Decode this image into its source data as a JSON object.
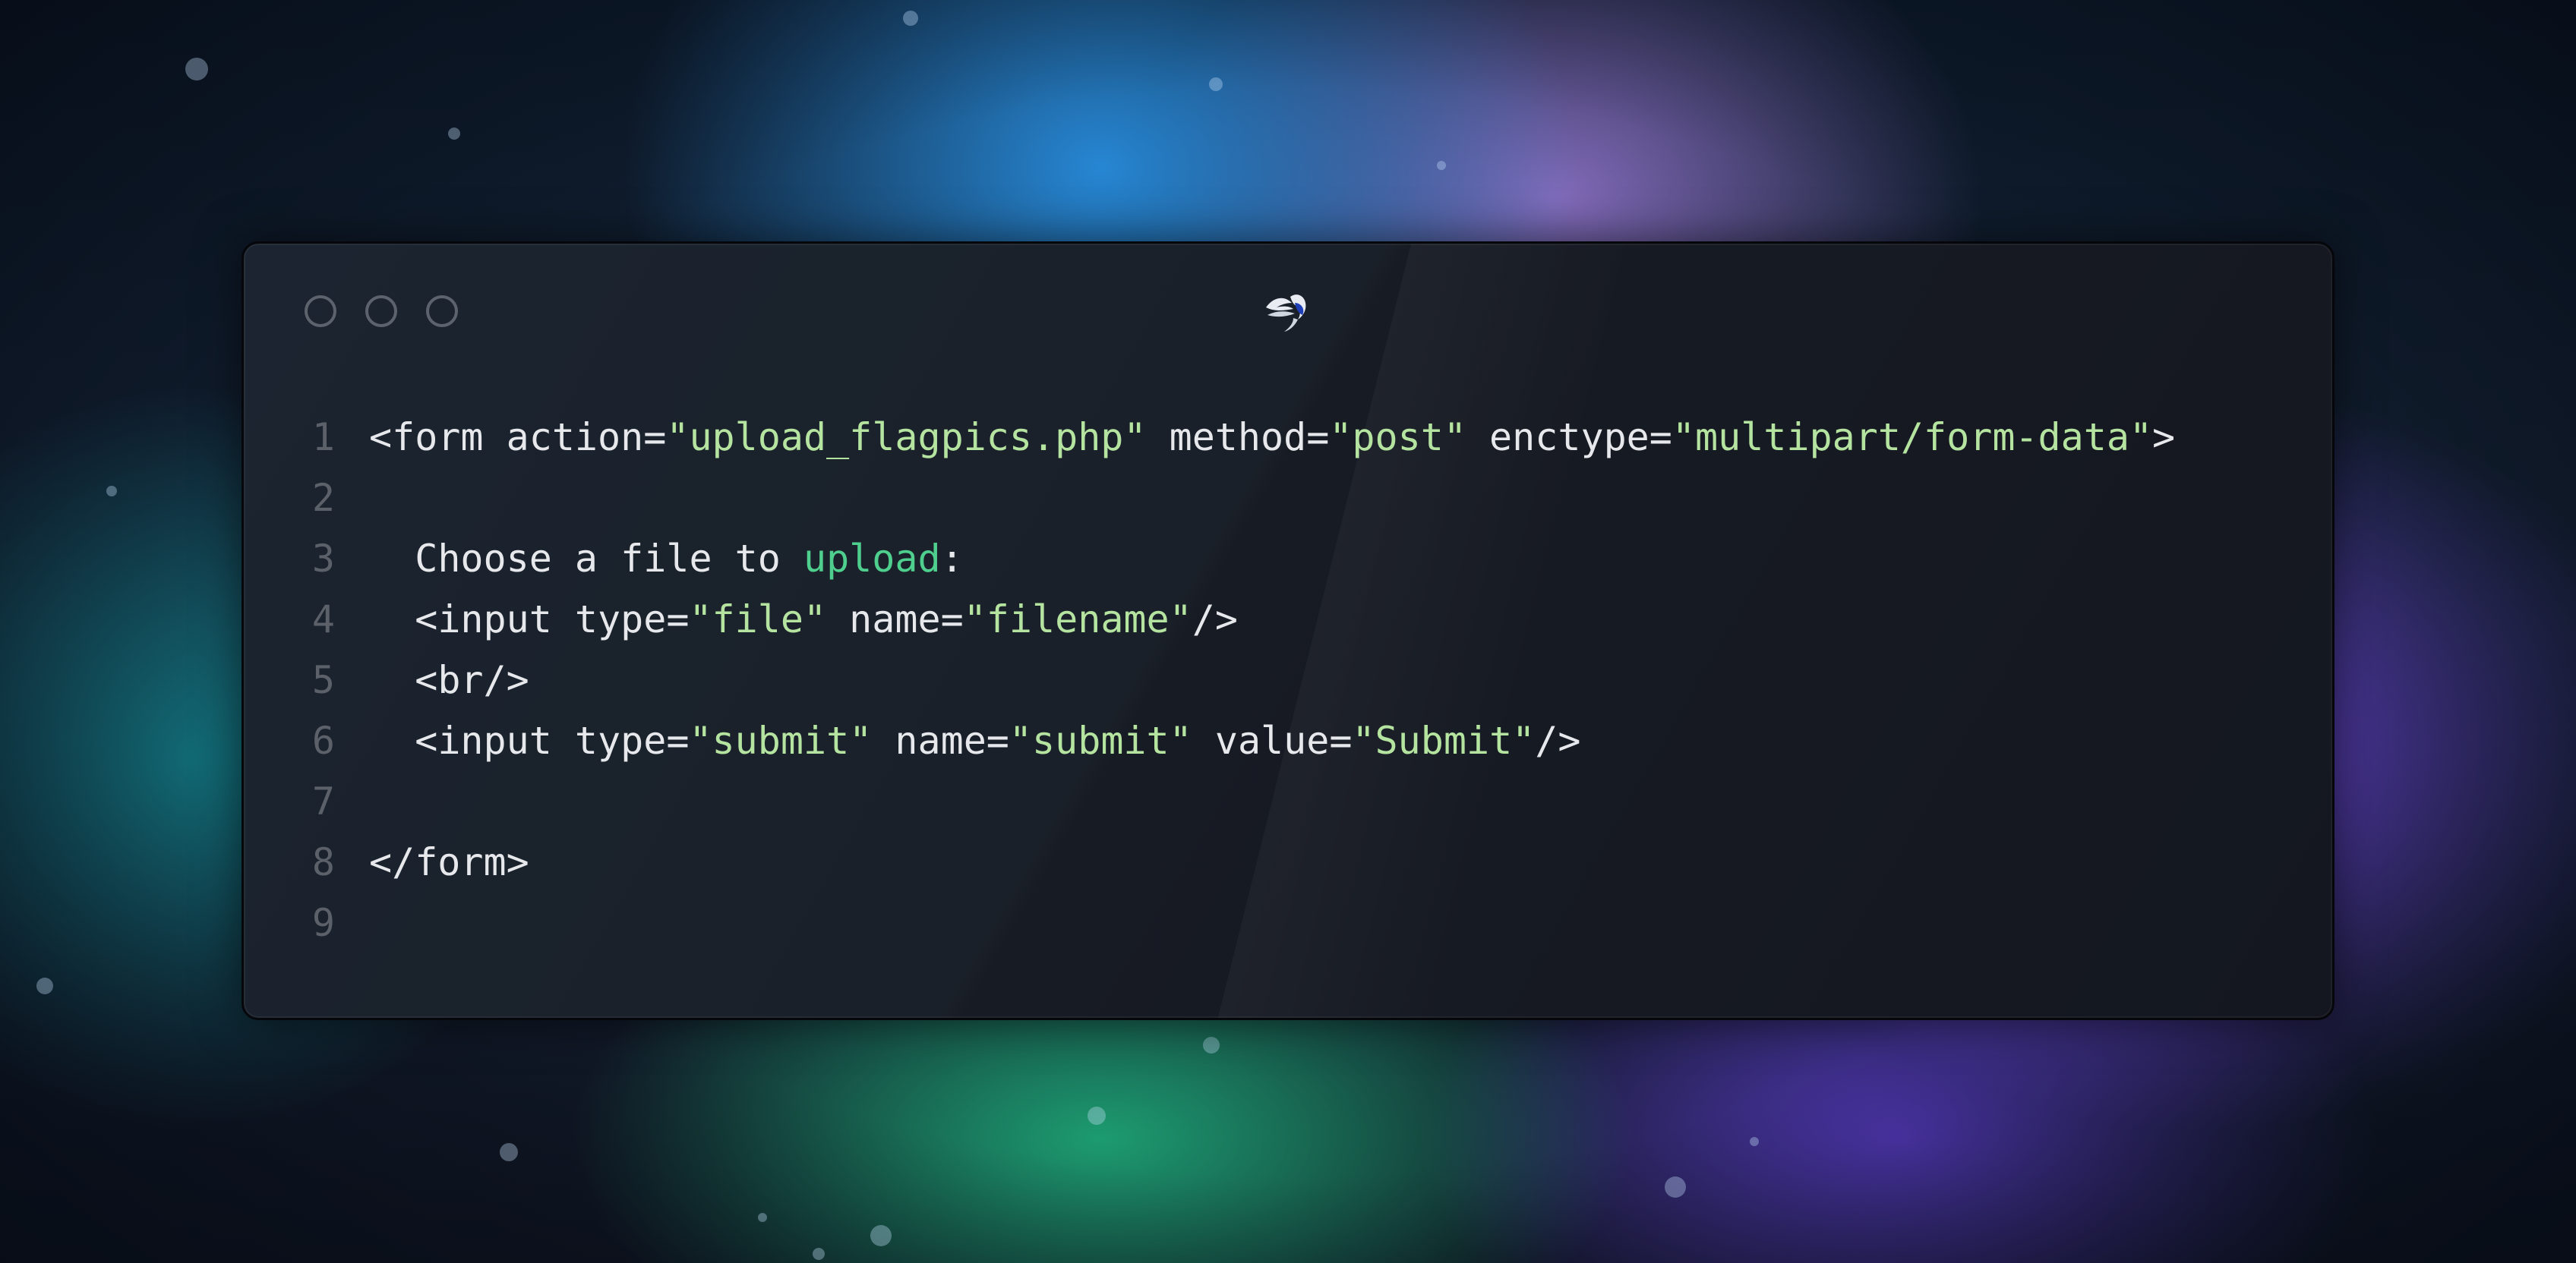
{
  "window": {
    "title_icon": "bird-logo-icon",
    "controls": [
      "close",
      "minimize",
      "maximize"
    ]
  },
  "code": {
    "language": "html",
    "lines": [
      {
        "number": "1",
        "indent": "",
        "tokens": [
          {
            "t": "<form action=",
            "k": "plain"
          },
          {
            "t": "\"upload_flagpics.php\"",
            "k": "str"
          },
          {
            "t": " method=",
            "k": "plain"
          },
          {
            "t": "\"post\"",
            "k": "str"
          },
          {
            "t": " enctype=",
            "k": "plain"
          },
          {
            "t": "\"multipart/form-data\"",
            "k": "str"
          },
          {
            "t": ">",
            "k": "plain"
          }
        ]
      },
      {
        "number": "2",
        "indent": "",
        "tokens": []
      },
      {
        "number": "3",
        "indent": "  ",
        "tokens": [
          {
            "t": "Choose a file to ",
            "k": "plain"
          },
          {
            "t": "upload",
            "k": "kw"
          },
          {
            "t": ":",
            "k": "plain"
          }
        ]
      },
      {
        "number": "4",
        "indent": "  ",
        "tokens": [
          {
            "t": "<input type=",
            "k": "plain"
          },
          {
            "t": "\"file\"",
            "k": "str"
          },
          {
            "t": " name=",
            "k": "plain"
          },
          {
            "t": "\"filename\"",
            "k": "str"
          },
          {
            "t": "/>",
            "k": "plain"
          }
        ]
      },
      {
        "number": "5",
        "indent": "  ",
        "tokens": [
          {
            "t": "<br/>",
            "k": "plain"
          }
        ]
      },
      {
        "number": "6",
        "indent": "  ",
        "tokens": [
          {
            "t": "<input type=",
            "k": "plain"
          },
          {
            "t": "\"submit\"",
            "k": "str"
          },
          {
            "t": " name=",
            "k": "plain"
          },
          {
            "t": "\"submit\"",
            "k": "str"
          },
          {
            "t": " value=",
            "k": "plain"
          },
          {
            "t": "\"Submit\"",
            "k": "str"
          },
          {
            "t": "/>",
            "k": "plain"
          }
        ]
      },
      {
        "number": "7",
        "indent": "",
        "tokens": []
      },
      {
        "number": "8",
        "indent": "",
        "tokens": [
          {
            "t": "</form>",
            "k": "plain"
          }
        ]
      },
      {
        "number": "9",
        "indent": "",
        "tokens": []
      }
    ]
  },
  "colors": {
    "string": "#b5e3a0",
    "keyword": "#4fcf8e",
    "text": "#e6e8eb",
    "line_number": "#5b6069",
    "window_bg": "#1a1f28"
  }
}
